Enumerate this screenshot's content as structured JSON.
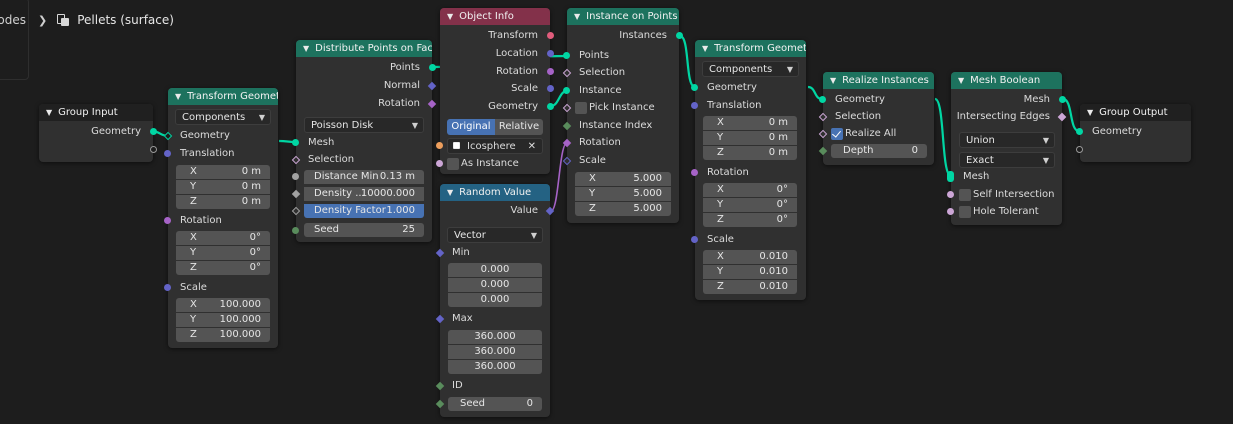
{
  "breadcrumb": {
    "partial": "Geometry Nodes",
    "object": "Pellets (surface)"
  },
  "group_input": {
    "title": "Group Input",
    "outputs": [
      "Geometry"
    ]
  },
  "transform1": {
    "title": "Transform Geometry",
    "mode": "Components",
    "inputs": [
      "Geometry",
      "Translation",
      "Rotation",
      "Scale"
    ],
    "translation": [
      {
        "k": "X",
        "v": "0 m"
      },
      {
        "k": "Y",
        "v": "0 m"
      },
      {
        "k": "Z",
        "v": "0 m"
      }
    ],
    "rotation": [
      {
        "k": "X",
        "v": "0°"
      },
      {
        "k": "Y",
        "v": "0°"
      },
      {
        "k": "Z",
        "v": "0°"
      }
    ],
    "scale": [
      {
        "k": "X",
        "v": "100.000"
      },
      {
        "k": "Y",
        "v": "100.000"
      },
      {
        "k": "Z",
        "v": "100.000"
      }
    ]
  },
  "distribute": {
    "title": "Distribute Points on Faces",
    "outputs": [
      "Points",
      "Normal",
      "Rotation"
    ],
    "method": "Poisson Disk",
    "inputs": [
      "Mesh",
      "Selection"
    ],
    "fields": [
      {
        "k": "Distance Min",
        "v": "0.13 m"
      },
      {
        "k": "Density ...",
        "v": "10000.000"
      },
      {
        "k": "Density Factor",
        "v": "1.000"
      },
      {
        "k": "Seed",
        "v": "25"
      }
    ]
  },
  "object_info": {
    "title": "Object Info",
    "outputs": [
      "Transform",
      "Location",
      "Rotation",
      "Scale",
      "Geometry"
    ],
    "seg": [
      "Original",
      "Relative"
    ],
    "object": "Icosphere",
    "as_instance": "As Instance"
  },
  "random_value": {
    "title": "Random Value",
    "output": "Value",
    "type": "Vector",
    "min_label": "Min",
    "min": [
      "0.000",
      "0.000",
      "0.000"
    ],
    "max_label": "Max",
    "max": [
      "360.000",
      "360.000",
      "360.000"
    ],
    "id_label": "ID",
    "seed_label": "Seed",
    "seed": "0"
  },
  "instance_on_points": {
    "title": "Instance on Points",
    "output": "Instances",
    "inputs": [
      "Points",
      "Selection",
      "Instance",
      "Pick Instance",
      "Instance Index",
      "Rotation",
      "Scale"
    ],
    "scale": [
      {
        "k": "X",
        "v": "5.000"
      },
      {
        "k": "Y",
        "v": "5.000"
      },
      {
        "k": "Z",
        "v": "5.000"
      }
    ]
  },
  "transform2": {
    "title": "Transform Geometry",
    "mode": "Components",
    "inputs": [
      "Geometry",
      "Translation",
      "Rotation",
      "Scale"
    ],
    "translation": [
      {
        "k": "X",
        "v": "0 m"
      },
      {
        "k": "Y",
        "v": "0 m"
      },
      {
        "k": "Z",
        "v": "0 m"
      }
    ],
    "rotation": [
      {
        "k": "X",
        "v": "0°"
      },
      {
        "k": "Y",
        "v": "0°"
      },
      {
        "k": "Z",
        "v": "0°"
      }
    ],
    "scale": [
      {
        "k": "X",
        "v": "0.010"
      },
      {
        "k": "Y",
        "v": "0.010"
      },
      {
        "k": "Z",
        "v": "0.010"
      }
    ]
  },
  "realize": {
    "title": "Realize Instances",
    "inputs": [
      "Geometry",
      "Selection"
    ],
    "realize_all": "Realize All",
    "depth_label": "Depth",
    "depth": "0"
  },
  "mesh_boolean": {
    "title": "Mesh Boolean",
    "outputs": [
      "Mesh",
      "Intersecting Edges"
    ],
    "operation": "Union",
    "solver": "Exact",
    "inputs": [
      "Mesh",
      "Self Intersection",
      "Hole Tolerant"
    ]
  },
  "group_output": {
    "title": "Group Output",
    "inputs": [
      "Geometry"
    ]
  },
  "colors": {
    "geometry": "#00d6a3",
    "vector": "#6363c7",
    "float": "#a1a1a1",
    "integer": "#598c5c",
    "boolean": "#cca6d6",
    "rotation": "#a663c7",
    "object": "#ed9e5c",
    "header_geometry": "#1d725e",
    "header_input": "#83314a",
    "header_utility": "#246283",
    "accent": "#4772b3"
  }
}
